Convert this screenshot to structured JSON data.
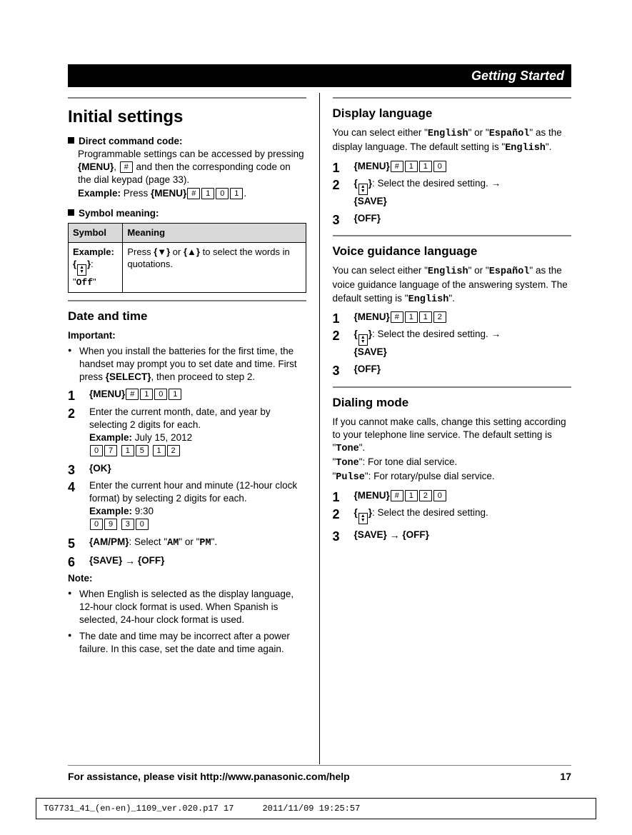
{
  "header": "Getting Started",
  "left": {
    "title": "Initial settings",
    "direct_label": "Direct command code:",
    "direct_body1": "Programmable settings can be accessed by pressing ",
    "direct_menu": "MENU",
    "direct_body2": ", ",
    "direct_body3": " and then the corresponding code on the dial keypad (page 33).",
    "example_label": "Example:",
    "example_press": " Press ",
    "symbol_heading": "Symbol meaning:",
    "sym_col1": "Symbol",
    "sym_col2": "Meaning",
    "sym_example": "Example:",
    "sym_off": "Off",
    "sym_meaning1": "Press ",
    "sym_meaning2": " or ",
    "sym_meaning3": " to select the words in quotations.",
    "dt_heading": "Date and time",
    "important": "Important:",
    "important_body": "When you install the batteries for the first time, the handset may prompt you to set date and time. First press {SELECT}, then proceed to step 2.",
    "steps": [
      {
        "text": "{MENU}#101",
        "menu": "MENU",
        "digits": [
          "#",
          "1",
          "0",
          "1"
        ]
      },
      {
        "text_a": "Enter the current month, date, and year by selecting 2 digits for each.",
        "ex_label": "Example:",
        "ex_text": " July 15, 2012",
        "digits": [
          "0",
          "7",
          "1",
          "5",
          "1",
          "2"
        ]
      },
      {
        "plain": "OK"
      },
      {
        "text_a": "Enter the current hour and minute (12-hour clock format) by selecting 2 digits for each.",
        "ex_label": "Example:",
        "ex_text": " 9:30",
        "digits": [
          "0",
          "9",
          "3",
          "0"
        ]
      },
      {
        "ampm": "AM/PM",
        "sel": ": Select ",
        "am": "AM",
        "or": " or ",
        "pm": "PM"
      },
      {
        "save": "SAVE",
        "arrow": " → ",
        "off": "OFF"
      }
    ],
    "note": "Note:",
    "note_items": [
      "When English is selected as the display language, 12-hour clock format is used. When Spanish is selected, 24-hour clock format is used.",
      "The date and time may be incorrect after a power failure. In this case, set the date and time again."
    ]
  },
  "right": {
    "sections": [
      {
        "heading": "Display language",
        "intro1": "You can select either \"",
        "eng": "English",
        "intro2": "\" or \"",
        "esp": "Español",
        "intro3": "\" as the display language. The default setting is \"",
        "intro4": "\".",
        "menu_digits": [
          "#",
          "1",
          "1",
          "0"
        ],
        "step2": ": Select the desired setting. →",
        "save": "SAVE",
        "off": "OFF"
      },
      {
        "heading": "Voice guidance language",
        "intro1": "You can select either \"",
        "eng": "English",
        "intro2": "\" or \"",
        "esp": "Español",
        "intro3": "\" as the voice guidance language of the answering system. The default setting is \"",
        "intro4": "\".",
        "menu_digits": [
          "#",
          "1",
          "1",
          "2"
        ],
        "step2": ": Select the desired setting. →",
        "save": "SAVE",
        "off": "OFF"
      },
      {
        "heading": "Dialing mode",
        "body1": "If you cannot make calls, change this setting according to your telephone line service. The default setting is \"",
        "tone": "Tone",
        "body2": "\".",
        "line_tone": "\": For tone dial service.",
        "pulse": "Pulse",
        "line_pulse": "\": For rotary/pulse dial service.",
        "menu_digits": [
          "#",
          "1",
          "2",
          "0"
        ],
        "step2": ": Select the desired setting.",
        "save": "SAVE",
        "off": "OFF"
      }
    ]
  },
  "footer": {
    "text": "For assistance, please visit http://www.panasonic.com/help",
    "page": "17"
  },
  "print": {
    "left": "TG7731_41_(en-en)_1109_ver.020.p17   17",
    "right": "2011/11/09   19:25:57"
  }
}
